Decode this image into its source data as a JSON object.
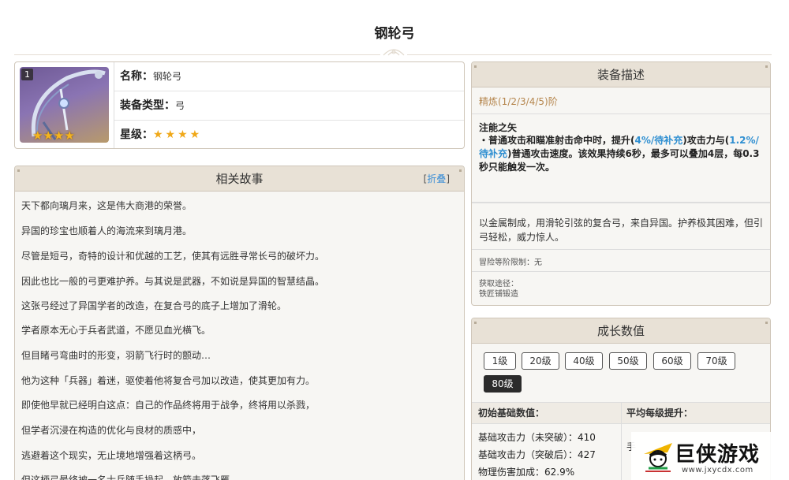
{
  "page_title": "钢轮弓",
  "info": {
    "name_key": "名称：",
    "name_val": "钢轮弓",
    "type_key": "装备类型：",
    "type_val": "弓",
    "rarity_key": "星级：",
    "rarity_stars": "★★★★",
    "level_badge": "1",
    "stars_overlay": "★★★★"
  },
  "story": {
    "title": "相关故事",
    "fold_open": "[",
    "fold_label": "折叠",
    "fold_close": "]",
    "lines": [
      "天下都向璃月来，这是伟大商港的荣誉。",
      "异国的珍宝也顺着人的海流来到璃月港。",
      "尽管是短弓，奇特的设计和优越的工艺，使其有远胜寻常长弓的破坏力。",
      "因此也比一般的弓更难护养。与其说是武器，不如说是异国的智慧结晶。",
      "这张弓经过了异国学者的改造，在复合弓的底子上增加了滑轮。",
      "学者原本无心于兵者武道，不愿见血光横飞。",
      "但目睹弓弯曲时的形变，羽箭飞行时的颤动…",
      "他为这种「兵器」着迷，驱使着他将复合弓加以改造，使其更加有力。",
      "即使他早就已经明白这点：自己的作品终将用于战争，终将用以杀戮，",
      "但学者沉浸在构造的优化与良材的质感中，",
      "逃避着这个现实，无止境地增强着这柄弓。",
      "但这柄弓最终被一名士兵随手操起，放箭击落飞雁。"
    ]
  },
  "desc": {
    "title": "装备描述",
    "refine": "精炼(1/2/3/4/5)阶",
    "passive_name": "注能之矢",
    "passive_p1": "・普通攻击和瞄准射击命中时，提升(",
    "passive_hl1": "4%/待补充",
    "passive_p2": ")攻击力与(",
    "passive_hl2": "1.2%/待补充",
    "passive_p3": ")普通攻击速度。该效果持续6秒，最多可以叠加4层，每0.3秒只能触发一次。",
    "flavor": "以金属制成，用滑轮引弦的复合弓，来自异国。护养极其困难，但引弓轻松，威力惊人。",
    "ascension_limit": "冒险等阶限制：无",
    "source_label": "获取途径：",
    "source_value": "铁匠铺锻造"
  },
  "growth": {
    "title": "成长数值",
    "levels": [
      "1级",
      "20级",
      "40级",
      "50级",
      "60级",
      "70级",
      "80级"
    ],
    "active_level": "80级",
    "col1": "初始基础数值：",
    "col2": "平均每级提升：",
    "stats": [
      "基础攻击力（未突破）：410",
      "基础攻击力（突破后）：427",
      "物理伤害加成：62.9%"
    ],
    "col2_fragment": "手"
  },
  "watermark": {
    "title": "巨侠游戏",
    "url": "www.jxycdx.com"
  },
  "colors": {
    "accent_blue": "#2f8fd1",
    "refine_gold": "#b6874f",
    "star_gold": "#f0a818",
    "panel_header": "#e8e1d6"
  }
}
